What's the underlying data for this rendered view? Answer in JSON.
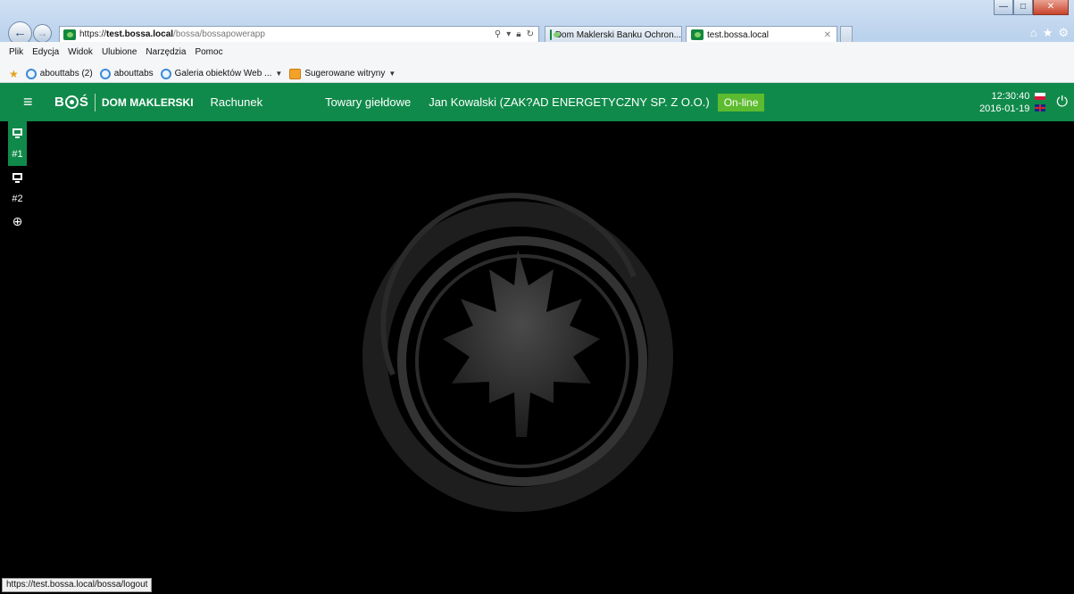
{
  "browser": {
    "url_scheme": "https://",
    "url_host": "test.bossa.local",
    "url_path": "/bossa/bossapowerapp",
    "tabs": [
      {
        "label": "Dom Maklerski Banku Ochron..."
      },
      {
        "label": "test.bossa.local"
      }
    ],
    "menu": [
      "Plik",
      "Edycja",
      "Widok",
      "Ulubione",
      "Narzędzia",
      "Pomoc"
    ],
    "favorites": [
      {
        "label": "abouttabs (2)"
      },
      {
        "label": "abouttabs"
      },
      {
        "label": "Galeria obiektów Web ..."
      },
      {
        "label": "Sugerowane witryny"
      }
    ],
    "status_url": "https://test.bossa.local/bossa/logout"
  },
  "app": {
    "brand_mark": "B",
    "brand_mark_end": "Ś",
    "brand_name": "DOM MAKLERSKI",
    "nav": {
      "rachunek": "Rachunek",
      "towary": "Towary giełdowe",
      "user": "Jan Kowalski (ZAK?AD ENERGETYCZNY SP. Z O.O.)"
    },
    "status": "On-line",
    "time": "12:30:40",
    "date": "2016-01-19",
    "colors": {
      "header": "#108a4a",
      "online": "#5dbb2f",
      "background": "#000000"
    }
  },
  "rail": {
    "items": [
      {
        "label": "#1"
      },
      {
        "label": "#2"
      }
    ]
  }
}
